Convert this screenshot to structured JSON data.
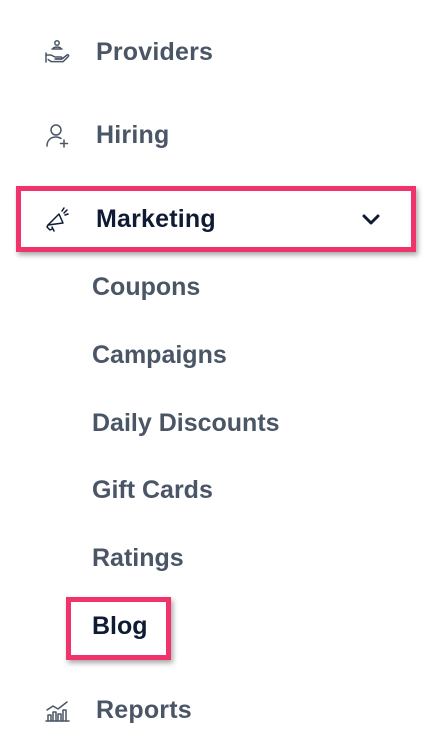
{
  "nav": {
    "items": [
      {
        "label": "Providers",
        "icon": "hand-coin-icon"
      },
      {
        "label": "Hiring",
        "icon": "user-plus-icon"
      },
      {
        "label": "Marketing",
        "icon": "megaphone-icon",
        "expanded": true
      },
      {
        "label": "Reports",
        "icon": "bar-chart-icon"
      }
    ],
    "marketing_sub": [
      {
        "label": "Coupons"
      },
      {
        "label": "Campaigns"
      },
      {
        "label": "Daily Discounts"
      },
      {
        "label": "Gift Cards"
      },
      {
        "label": "Ratings"
      },
      {
        "label": "Blog",
        "active": true
      }
    ]
  },
  "colors": {
    "highlight": "#f0336b",
    "text": "#4a5566",
    "active_text": "#0e1b33"
  }
}
